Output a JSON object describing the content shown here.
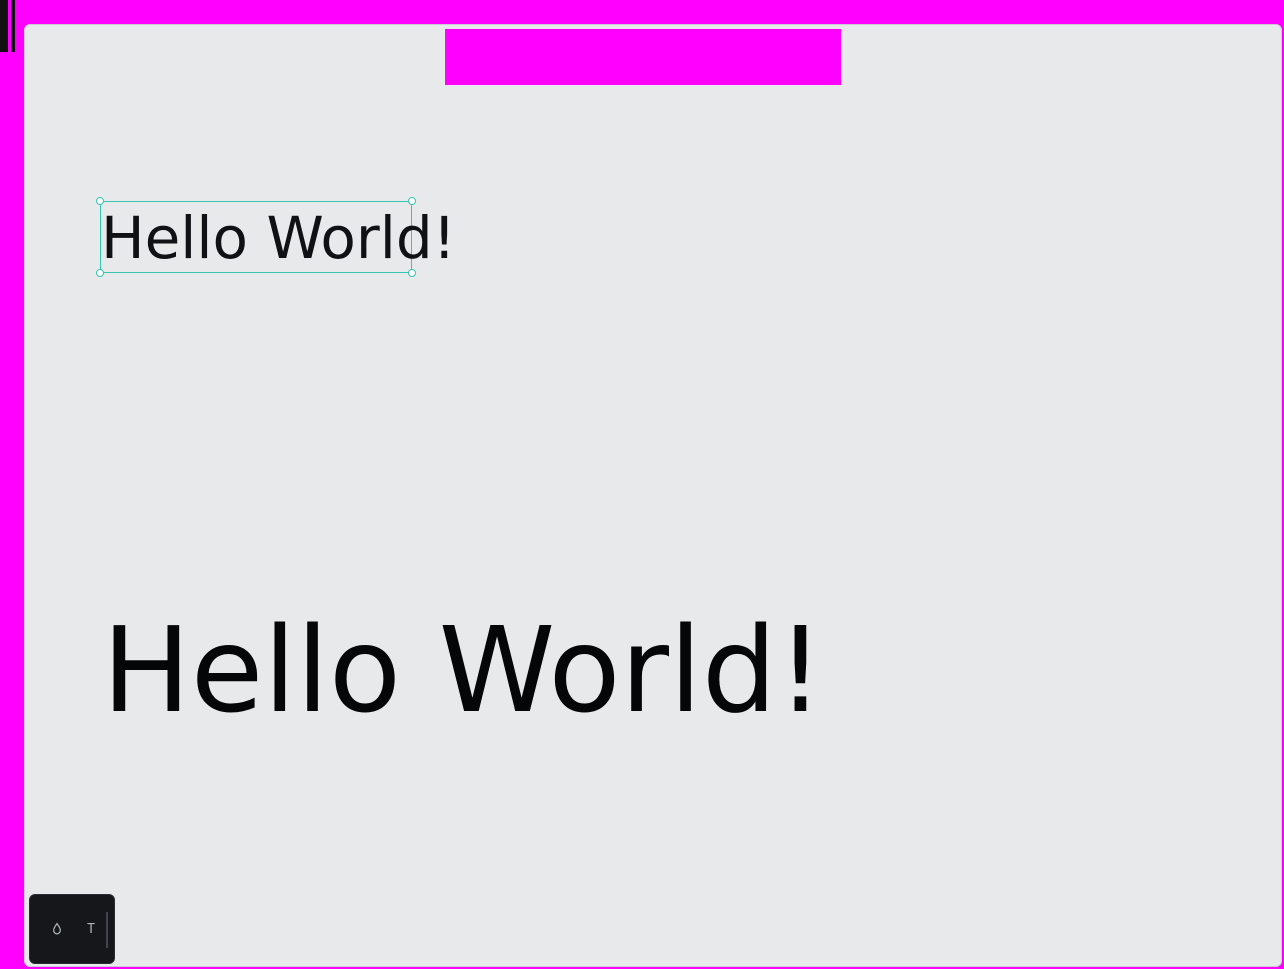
{
  "canvas": {
    "text_box_small": {
      "text": "Hello World!",
      "selected": true,
      "selection_color": "#35c6b3"
    },
    "text_box_large": {
      "text": "Hello World!"
    }
  },
  "toolbar": {
    "tools": [
      {
        "icon": "droplet-icon",
        "label": ""
      },
      {
        "icon": "text-icon",
        "label": "T"
      }
    ]
  },
  "colors": {
    "background": "#ff00ff",
    "canvas": "#e8e9eb",
    "toolbar": "#15171b",
    "text": "#050608"
  }
}
